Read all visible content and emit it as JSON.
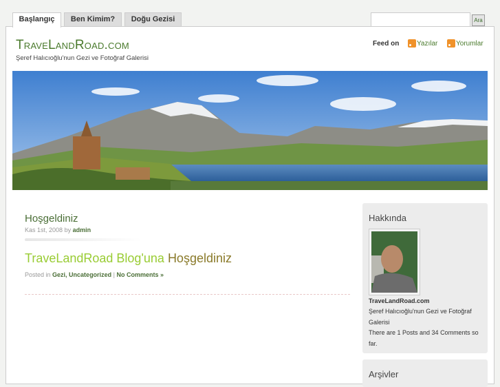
{
  "nav": {
    "tabs": [
      {
        "label": "Başlangıç",
        "active": true
      },
      {
        "label": "Ben Kimim?"
      },
      {
        "label": "Doğu Gezisi"
      }
    ]
  },
  "search": {
    "value": "",
    "button": "Ara"
  },
  "header": {
    "title": "TraveLandRoad.com",
    "tagline": "Şeref Halıcıoğlu'nun Gezi ve Fotoğraf Galerisi",
    "feed_label": "Feed on",
    "feeds": [
      "Yazılar",
      "Yorumlar"
    ]
  },
  "post": {
    "title": "Hoşgeldiniz",
    "date": "Kas 1st, 2008",
    "by": "by",
    "author": "admin",
    "headline_a": "TraveLandRoad Blog'una",
    "headline_b": "Hoşgeldiniz",
    "posted_in": "Posted in",
    "categories": "Gezi, Uncategorized",
    "sep": "|",
    "comments": "No Comments »"
  },
  "sidebar": {
    "about_title": "Hakkında",
    "site": "TraveLandRoad.com",
    "desc": "Şeref Halıcıoğlu'nun Gezi ve Fotoğraf Galerisi",
    "stats": "There are 1 Posts and 34 Comments so far.",
    "archives_title": "Arşivler"
  }
}
